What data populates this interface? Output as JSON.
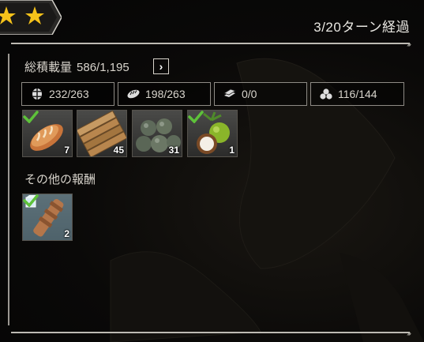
{
  "header": {
    "stars": 2,
    "turn_status": "3/20ターン経過"
  },
  "capacity": {
    "label": "総積載量",
    "value": "586/1,195",
    "detail_button": "›"
  },
  "stats": [
    {
      "icon": "barrel-icon",
      "value": "232/263"
    },
    {
      "icon": "bread-icon",
      "value": "198/263"
    },
    {
      "icon": "cloth-stack-icon",
      "value": "0/0"
    },
    {
      "icon": "ore-cluster-icon",
      "value": "116/144"
    }
  ],
  "cargo": [
    {
      "name": "bread",
      "qty": "7",
      "checked": true
    },
    {
      "name": "lumber",
      "qty": "45",
      "checked": false
    },
    {
      "name": "stones",
      "qty": "31",
      "checked": false
    },
    {
      "name": "coconut",
      "qty": "1",
      "checked": true
    }
  ],
  "other_rewards": {
    "label": "その他の報酬",
    "items": [
      {
        "name": "torch",
        "qty": "2",
        "checked": true
      }
    ]
  },
  "colors": {
    "star": "#f5c21a",
    "check": "#5ec23a",
    "rule": "#bdbab3"
  }
}
